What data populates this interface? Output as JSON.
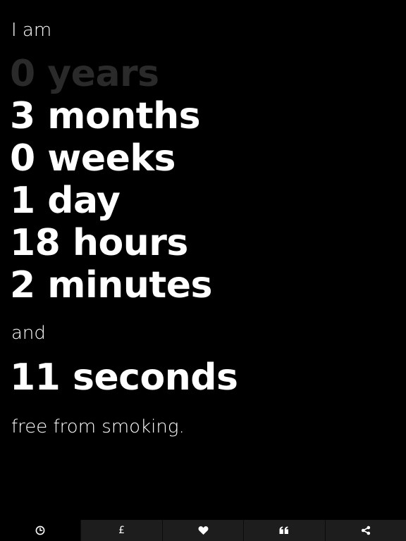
{
  "counter": {
    "intro": "I am",
    "units": [
      {
        "label": "0 years",
        "dim": true
      },
      {
        "label": "3 months",
        "dim": false
      },
      {
        "label": "0 weeks",
        "dim": false
      },
      {
        "label": "1 day",
        "dim": false
      },
      {
        "label": "18 hours",
        "dim": false
      },
      {
        "label": "2 minutes",
        "dim": false
      }
    ],
    "conjunction": "and",
    "seconds": "11 seconds",
    "outro": "free from smoking."
  },
  "tabs": [
    {
      "id": "timer",
      "icon": "clock-icon",
      "active": true
    },
    {
      "id": "money",
      "icon": "pound-icon",
      "glyph": "£",
      "active": false
    },
    {
      "id": "health",
      "icon": "heart-icon",
      "active": false
    },
    {
      "id": "quotes",
      "icon": "quote-icon",
      "active": false
    },
    {
      "id": "share",
      "icon": "share-icon",
      "active": false
    }
  ],
  "colors": {
    "background": "#000000",
    "text": "#ffffff",
    "dim_text": "#2a2a2a",
    "tab_background": "#1d1d1d",
    "tab_active_background": "#000000"
  }
}
